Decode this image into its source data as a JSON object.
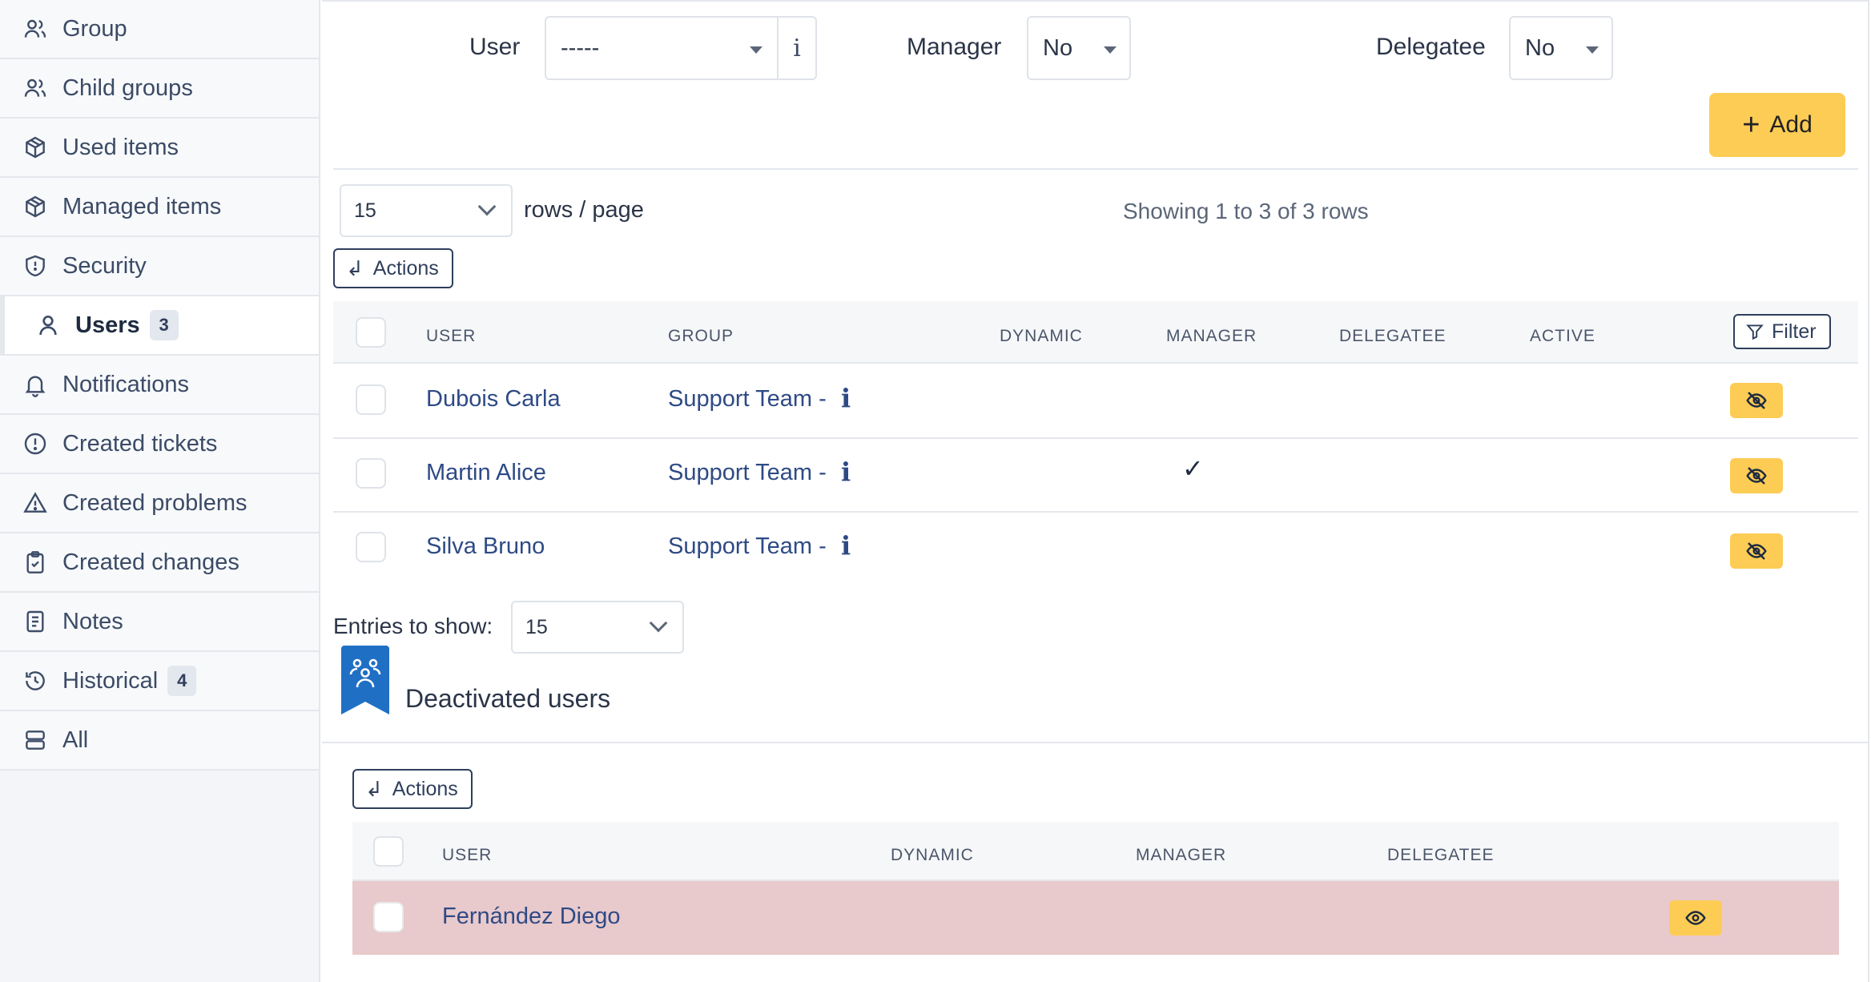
{
  "sidebar": {
    "items": [
      {
        "label": "Group",
        "icon": "users-icon",
        "name": "sidebar-item-group"
      },
      {
        "label": "Child groups",
        "icon": "users-icon",
        "name": "sidebar-item-child-groups"
      },
      {
        "label": "Used items",
        "icon": "box-icon",
        "name": "sidebar-item-used-items"
      },
      {
        "label": "Managed items",
        "icon": "box-icon",
        "name": "sidebar-item-managed-items"
      },
      {
        "label": "Security",
        "icon": "shield-icon",
        "name": "sidebar-item-security"
      },
      {
        "label": "Users",
        "icon": "user-icon",
        "name": "sidebar-item-users",
        "badge": "3",
        "active": true
      },
      {
        "label": "Notifications",
        "icon": "bell-icon",
        "name": "sidebar-item-notifications"
      },
      {
        "label": "Created tickets",
        "icon": "alert-circle-icon",
        "name": "sidebar-item-created-tickets"
      },
      {
        "label": "Created problems",
        "icon": "alert-triangle-icon",
        "name": "sidebar-item-created-problems"
      },
      {
        "label": "Created changes",
        "icon": "clipboard-check-icon",
        "name": "sidebar-item-created-changes"
      },
      {
        "label": "Notes",
        "icon": "notes-icon",
        "name": "sidebar-item-notes"
      },
      {
        "label": "Historical",
        "icon": "history-icon",
        "name": "sidebar-item-historical",
        "badge": "4"
      },
      {
        "label": "All",
        "icon": "stack-icon",
        "name": "sidebar-item-all"
      }
    ]
  },
  "form": {
    "user_label": "User",
    "user_value": "-----",
    "user_info": "i",
    "manager_label": "Manager",
    "manager_value": "No",
    "delegatee_label": "Delegatee",
    "delegatee_value": "No",
    "add_label": "Add"
  },
  "table": {
    "rows_per_page": "15",
    "rows_page_label": "rows / page",
    "showing": "Showing 1 to 3 of 3 rows",
    "actions_label": "Actions",
    "filter_label": "Filter",
    "headers": {
      "user": "USER",
      "group": "GROUP",
      "dynamic": "DYNAMIC",
      "manager": "MANAGER",
      "delegatee": "DELEGATEE",
      "active": "ACTIVE"
    },
    "rows": [
      {
        "user": "Dubois Carla",
        "group": "Support Team -",
        "info": "i",
        "manager": ""
      },
      {
        "user": "Martin Alice",
        "group": "Support Team -",
        "info": "i",
        "manager": "✓"
      },
      {
        "user": "Silva Bruno",
        "group": "Support Team -",
        "info": "i",
        "manager": ""
      }
    ],
    "entries_label": "Entries to show:",
    "entries_value": "15"
  },
  "deactivated": {
    "title": "Deactivated users",
    "actions_label": "Actions",
    "headers": {
      "user": "USER",
      "dynamic": "DYNAMIC",
      "manager": "MANAGER",
      "delegatee": "DELEGATEE"
    },
    "rows": [
      {
        "user": "Fernández Diego"
      }
    ]
  },
  "colors": {
    "accent": "#fdcc55",
    "link": "#2e4a85",
    "deactivated_row": "#e8c9cc",
    "ribbon": "#1f6fc5"
  }
}
